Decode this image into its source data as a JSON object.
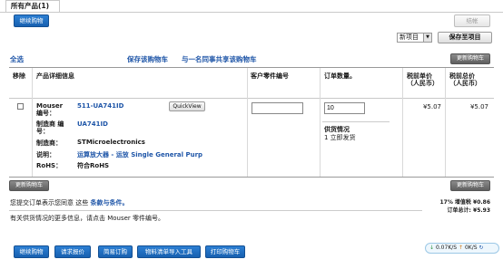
{
  "tab": {
    "label": "所有产品(1)"
  },
  "toolbar": {
    "continue_shopping": "继续购物",
    "clear_label": "结帐"
  },
  "view_select": {
    "value": "新项目",
    "save_button": "保存至项目"
  },
  "links": {
    "select_all": "全选",
    "save_cart": "保存该购物车",
    "share_cart": "与一名同事共享该购物车",
    "update_cart": "更新购物车"
  },
  "table": {
    "headers": {
      "remove": "移除",
      "details": "产品详细信息",
      "customer_part": "客户零件编号",
      "quantity": "订单数量。",
      "unit_price": "税前单价（人民币）",
      "ext_price": "税前总价（人民币）"
    },
    "row": {
      "mouser_no_label": "Mouser 编号：",
      "mouser_no": "511-UA741ID",
      "quickview": "QuickView",
      "mfr_no_label": "制造商 编号：",
      "mfr_no": "UA741ID",
      "mfr_label": "制造商：",
      "mfr": "STMicroelectronics",
      "desc_label": "说明：",
      "desc": "运算放大器 - 运放 Single General Purp",
      "rohs_label": "RoHS：",
      "rohs": "符合RoHS",
      "quantity": "10",
      "availability_label": "供货情况",
      "availability": "1 立即发货",
      "unit_price": "¥5.07",
      "ext_price": "¥5.07"
    }
  },
  "footer": {
    "update_left": "更新购物车",
    "update_right": "更新购物车",
    "terms_prefix": "您提交订单表示您同意 这些",
    "terms_link": "条款与条件。",
    "vat_label": "17% 增值税",
    "vat_value": "¥0.86",
    "total_label": "订单总计:",
    "total_value": "¥5.93",
    "availability_note": "有关供货情况的更多信息，请点击 Mouser 零件编号。"
  },
  "bottom_buttons": [
    "继续购物",
    "请求报价",
    "简易订购",
    "物料清单导入工具",
    "打印购物车"
  ],
  "net_widget": {
    "down": "0.07K/S",
    "up": "0K/S"
  }
}
